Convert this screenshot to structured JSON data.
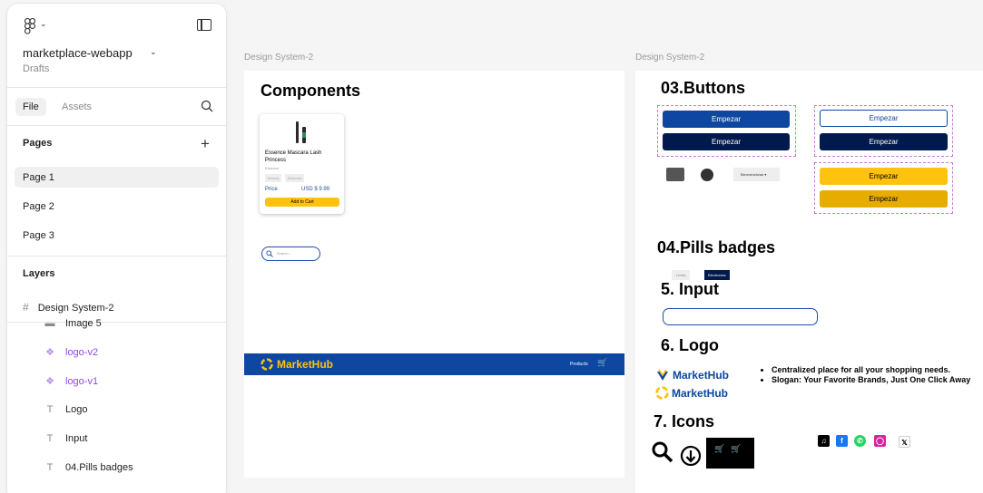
{
  "sidebar": {
    "file_name": "marketplace-webapp",
    "file_location": "Drafts",
    "tabs": {
      "file": "File",
      "assets": "Assets"
    },
    "pages_heading": "Pages",
    "pages": [
      "Page 1",
      "Page 2",
      "Page 3"
    ],
    "selected_page": "Page 1",
    "layers_heading": "Layers",
    "frame_layer": "Design System-2",
    "layers": [
      {
        "label": "Image 5",
        "type": "image"
      },
      {
        "label": "logo-v2",
        "type": "component"
      },
      {
        "label": "logo-v1",
        "type": "component"
      },
      {
        "label": "Logo",
        "type": "text"
      },
      {
        "label": "Input",
        "type": "text"
      },
      {
        "label": "04.Pills badges",
        "type": "text"
      }
    ]
  },
  "canvas": {
    "frame_labels": [
      "Design System-2",
      "Design System-2"
    ],
    "frame1": {
      "title": "Components",
      "card": {
        "name": "Essence Mascara Lash Princess",
        "brand": "Essence",
        "tags": [
          "Beauty",
          "Mascara"
        ],
        "price_label": "Price",
        "price": "USD $ 9.99",
        "cta": "Add to Cart"
      },
      "search_placeholder": "Search...",
      "navbar": {
        "brand": "MarketHub",
        "link": "Products"
      }
    },
    "frame2": {
      "buttons_heading": "03.Buttons",
      "button_label": "Empezar",
      "dropdown_label": "Bienvenido/as",
      "pills_heading": "04.Pills badges",
      "badges": [
        "Limits",
        "Electronics"
      ],
      "input_heading": "5. Input",
      "logo_heading": "6. Logo",
      "logo_text": "MarketHub",
      "bullets": [
        "Centralized place for all your shopping needs.",
        "Slogan: Your Favorite Brands, Just One Click Away"
      ],
      "icons_heading": "7. Icons"
    }
  },
  "colors": {
    "primary_blue": "#0d47a1",
    "navy": "#001a4d",
    "yellow": "#ffc20e",
    "gold": "#e6ac00",
    "component_purple": "#8f47e6"
  }
}
